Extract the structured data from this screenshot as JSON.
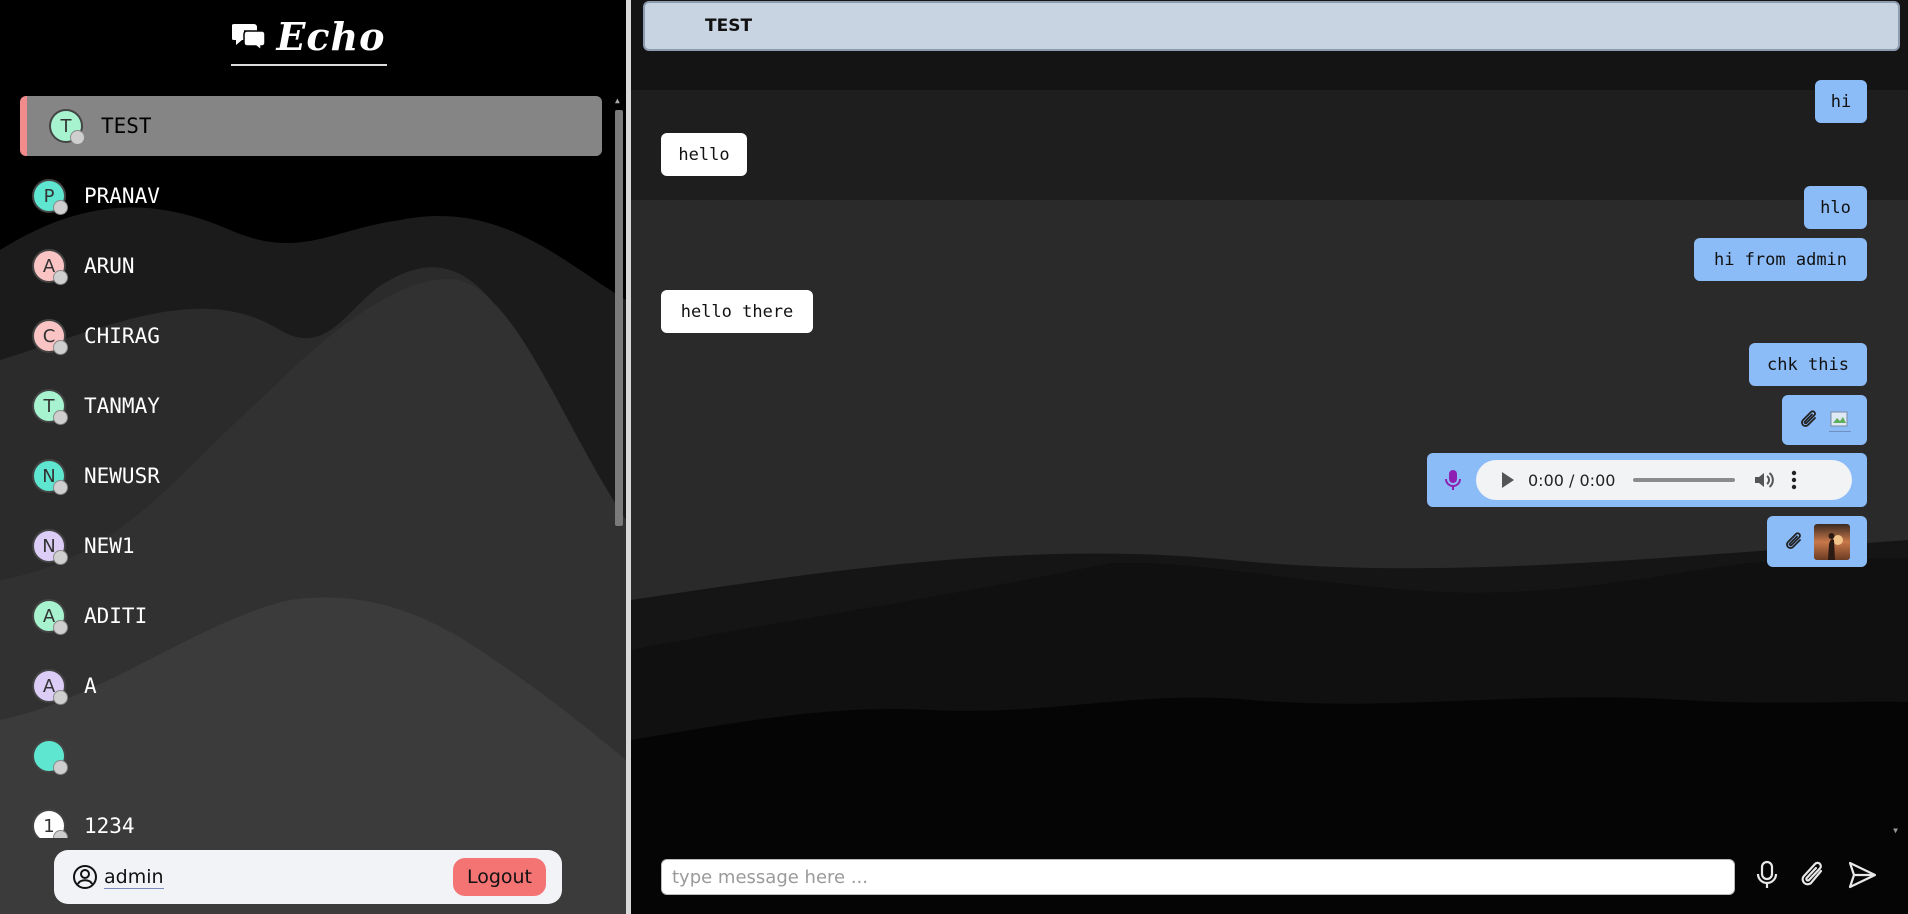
{
  "app": {
    "brand_name": "Echo",
    "brand_icon": "chat-bubbles-icon"
  },
  "sidebar": {
    "contacts": [
      {
        "initial": "T",
        "name": "TEST",
        "avatar_color": "#a7f3d0",
        "active": true
      },
      {
        "initial": "P",
        "name": "PRANAV",
        "avatar_color": "#5ee6d0"
      },
      {
        "initial": "A",
        "name": "ARUN",
        "avatar_color": "#fbc4c4"
      },
      {
        "initial": "C",
        "name": "CHIRAG",
        "avatar_color": "#fbc4c4"
      },
      {
        "initial": "T",
        "name": "TANMAY",
        "avatar_color": "#a7f3d0"
      },
      {
        "initial": "N",
        "name": "NEWUSR",
        "avatar_color": "#5ee6d0"
      },
      {
        "initial": "N",
        "name": "NEW1",
        "avatar_color": "#dccdf7"
      },
      {
        "initial": "A",
        "name": "ADITI",
        "avatar_color": "#a7f3d0"
      },
      {
        "initial": "A",
        "name": "A",
        "avatar_color": "#dccdf7"
      },
      {
        "initial": "",
        "name": "",
        "avatar_color": "#5ee6d0"
      },
      {
        "initial": "1",
        "name": "1234",
        "avatar_color": "#ffffff"
      }
    ],
    "user": {
      "name": "admin",
      "icon": "user-circle-icon",
      "logout_label": "Logout"
    }
  },
  "chat": {
    "title": "TEST",
    "messages": [
      {
        "dir": "out",
        "type": "text",
        "text": "hi"
      },
      {
        "dir": "in",
        "type": "text",
        "text": "hello"
      },
      {
        "dir": "out",
        "type": "text",
        "text": "hlo"
      },
      {
        "dir": "out",
        "type": "text",
        "text": "hi from admin"
      },
      {
        "dir": "in",
        "type": "text",
        "text": "hello there"
      },
      {
        "dir": "out",
        "type": "text",
        "text": "chk this"
      },
      {
        "dir": "out",
        "type": "attachment",
        "icon": "paperclip-icon",
        "preview": "broken-image"
      },
      {
        "dir": "out",
        "type": "audio",
        "icon": "microphone-icon",
        "time": "0:00 / 0:00"
      },
      {
        "dir": "out",
        "type": "attachment",
        "icon": "paperclip-icon",
        "preview": "photo-thumbnail"
      }
    ],
    "composer": {
      "placeholder": "type message here ..."
    },
    "tools": [
      "microphone-icon",
      "paperclip-icon",
      "send-icon"
    ]
  },
  "colors": {
    "outgoing_bubble": "#8bbcf7",
    "incoming_bubble": "#ffffff",
    "header": "#c9d4e2",
    "logout": "#f47474",
    "active_contact": "#858585",
    "active_accent": "#f28b8b"
  }
}
